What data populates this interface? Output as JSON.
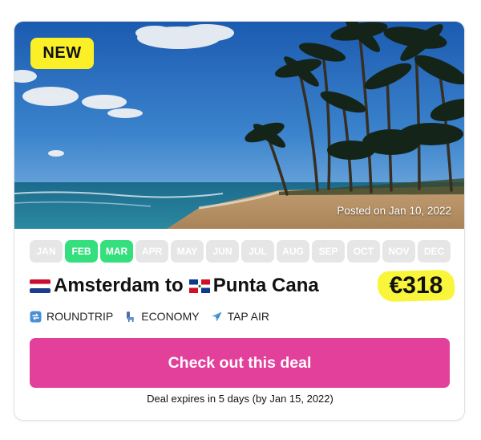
{
  "badge": {
    "label": "NEW",
    "color": "#fbf027"
  },
  "hero": {
    "posted_text": "Posted on Jan 10, 2022"
  },
  "months": [
    {
      "label": "JAN",
      "active": false
    },
    {
      "label": "FEB",
      "active": true
    },
    {
      "label": "MAR",
      "active": true
    },
    {
      "label": "APR",
      "active": false
    },
    {
      "label": "MAY",
      "active": false
    },
    {
      "label": "JUN",
      "active": false
    },
    {
      "label": "JUL",
      "active": false
    },
    {
      "label": "AUG",
      "active": false
    },
    {
      "label": "SEP",
      "active": false
    },
    {
      "label": "OCT",
      "active": false
    },
    {
      "label": "NOV",
      "active": false
    },
    {
      "label": "DEC",
      "active": false
    }
  ],
  "route": {
    "origin": "Amsterdam",
    "connector": "to",
    "destination": "Punta Cana",
    "origin_flag_icon": "netherlands-flag-icon",
    "destination_flag_icon": "dominican-republic-flag-icon"
  },
  "price": {
    "value": "€318",
    "highlight_color": "#f8f53a"
  },
  "tags": [
    {
      "icon": "roundtrip-icon",
      "label": "ROUNDTRIP"
    },
    {
      "icon": "seat-icon",
      "label": "ECONOMY"
    },
    {
      "icon": "airplane-icon",
      "label": "TAP AIR"
    }
  ],
  "cta": {
    "label": "Check out this deal",
    "color": "#e2409b"
  },
  "expires_text": "Deal expires in 5 days (by Jan 15, 2022)",
  "colors": {
    "month_active": "#36df7d",
    "month_inactive": "#e6e6e6"
  }
}
